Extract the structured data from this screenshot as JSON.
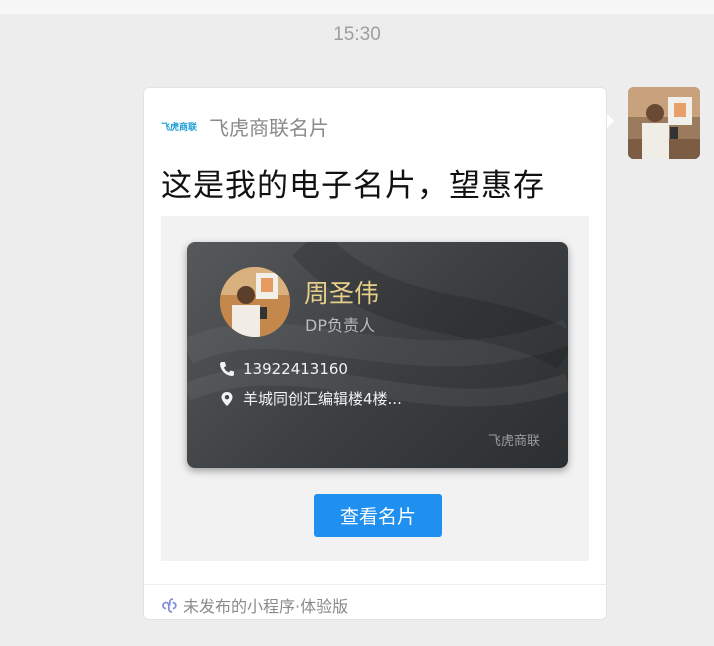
{
  "status": {
    "time": "15:30"
  },
  "message": {
    "app_logo_text": "飞虎商联",
    "app_name": "飞虎商联名片",
    "title": "这是我的电子名片，望惠存",
    "card": {
      "name": "周圣伟",
      "position": "DP负责人",
      "phone": "13922413160",
      "address": "羊城同创汇编辑楼4楼...",
      "brand": "飞虎商联"
    },
    "button_label": "查看名片",
    "footer_label": "未发布的小程序·体验版"
  },
  "icons": {
    "phone": "phone-icon",
    "location": "location-pin-icon",
    "miniprogram": "mini-program-icon"
  },
  "colors": {
    "button": "#1f8ff0",
    "card_name": "#e7cf8a",
    "logo": "#1e9ed6"
  }
}
